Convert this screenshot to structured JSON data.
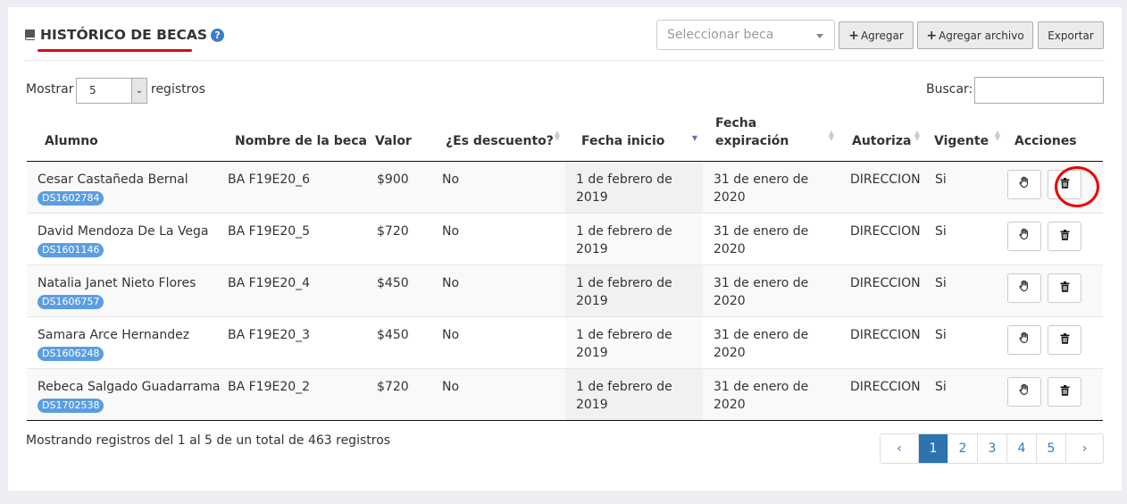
{
  "header": {
    "title": "HISTÓRICO DE BECAS",
    "help": "?",
    "select_placeholder": "Seleccionar beca",
    "btn_agregar": "Agregar",
    "btn_agregar_archivo": "Agregar archivo",
    "btn_exportar": "Exportar",
    "plus": "+"
  },
  "controls": {
    "mostrar": "Mostrar",
    "length_value": "5",
    "registros": "registros",
    "buscar": "Buscar:"
  },
  "columns": {
    "alumno": "Alumno",
    "nombre": "Nombre de la beca",
    "valor": "Valor",
    "descuento": "¿Es descuento?",
    "fecha_inicio": "Fecha inicio",
    "fecha_exp": "Fecha expiración",
    "autoriza": "Autoriza",
    "vigente": "Vigente",
    "acciones": "Acciones"
  },
  "rows": [
    {
      "alumno": "Cesar Castañeda Bernal",
      "id": "DS1602784",
      "beca": "BA F19E20_6",
      "valor": "$900",
      "descuento": "No",
      "inicio": "1 de febrero de 2019",
      "exp": "31 de enero de 2020",
      "autoriza": "DIRECCION",
      "vigente": "Si"
    },
    {
      "alumno": "David Mendoza De La Vega",
      "id": "DS1601146",
      "beca": "BA F19E20_5",
      "valor": "$720",
      "descuento": "No",
      "inicio": "1 de febrero de 2019",
      "exp": "31 de enero de 2020",
      "autoriza": "DIRECCION",
      "vigente": "Si"
    },
    {
      "alumno": "Natalia Janet Nieto Flores",
      "id": "DS1606757",
      "beca": "BA F19E20_4",
      "valor": "$450",
      "descuento": "No",
      "inicio": "1 de febrero de 2019",
      "exp": "31 de enero de 2020",
      "autoriza": "DIRECCION",
      "vigente": "Si"
    },
    {
      "alumno": "Samara Arce Hernandez",
      "id": "DS1606248",
      "beca": "BA F19E20_3",
      "valor": "$450",
      "descuento": "No",
      "inicio": "1 de febrero de 2019",
      "exp": "31 de enero de 2020",
      "autoriza": "DIRECCION",
      "vigente": "Si"
    },
    {
      "alumno": "Rebeca Salgado Guadarrama",
      "id": "DS1702538",
      "beca": "BA F19E20_2",
      "valor": "$720",
      "descuento": "No",
      "inicio": "1 de febrero de 2019",
      "exp": "31 de enero de 2020",
      "autoriza": "DIRECCION",
      "vigente": "Si"
    }
  ],
  "footer": {
    "info": "Mostrando registros del 1 al 5 de un total de 463 registros",
    "prev": "‹",
    "next": "›",
    "pages": [
      "1",
      "2",
      "3",
      "4",
      "5"
    ]
  },
  "colors": {
    "accent": "#2f72b0",
    "badge": "#5b9ee0",
    "underline": "#d40f0f"
  }
}
